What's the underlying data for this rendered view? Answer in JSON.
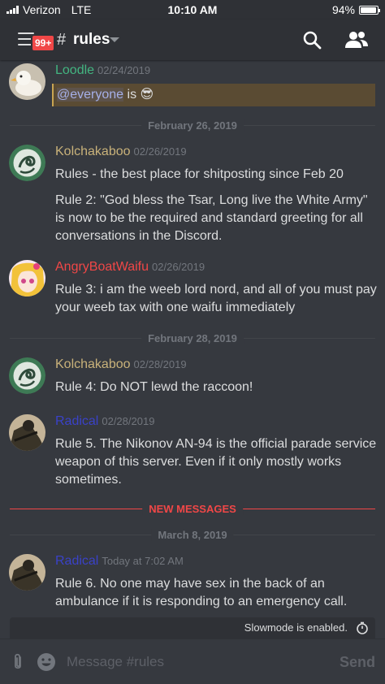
{
  "status": {
    "carrier": "Verizon",
    "network": "LTE",
    "time": "10:10 AM",
    "battery": "94%",
    "battery_level": 0.94
  },
  "header": {
    "badge": "99+",
    "hash": "#",
    "channel": "rules"
  },
  "messages": [
    {
      "author": "Loodle",
      "author_color": "#43b581",
      "timestamp": "02/24/2019",
      "mention": "@everyone",
      "text": " is 😎"
    },
    {
      "divider": "February 26, 2019"
    },
    {
      "author": "Kolchakaboo",
      "author_color": "#c9b27a",
      "timestamp": "02/26/2019",
      "lines": [
        "Rules - the best place for shitposting since Feb 20",
        "Rule 2: \"God bless the Tsar, Long live the White Army\" is now to be the required and standard greeting for all conversations in the Discord."
      ]
    },
    {
      "author": "AngryBoatWaifu",
      "author_color": "#f04747",
      "timestamp": "02/26/2019",
      "lines": [
        "Rule 3: i am the weeb lord nord, and all of you must pay your weeb tax with one waifu immediately"
      ]
    },
    {
      "divider": "February 28, 2019"
    },
    {
      "author": "Kolchakaboo",
      "author_color": "#c9b27a",
      "timestamp": "02/28/2019",
      "lines": [
        "Rule 4: Do NOT lewd the raccoon!"
      ]
    },
    {
      "author": "Radical",
      "author_color": "#3a42c8",
      "timestamp": "02/28/2019",
      "lines": [
        "Rule 5. The Nikonov AN-94 is the official parade service weapon of this server. Even if it only mostly works sometimes."
      ]
    },
    {
      "divider": "NEW MESSAGES"
    },
    {
      "divider": "March 8, 2019"
    },
    {
      "author": "Radical",
      "author_color": "#3a42c8",
      "timestamp": "Today at 7:02 AM",
      "lines": [
        "Rule 6. No one may have sex in the back of an ambulance if it is responding to an emergency call."
      ]
    }
  ],
  "slowmode": "Slowmode is enabled.",
  "composer": {
    "placeholder": "Message #rules",
    "send": "Send"
  },
  "icons": {
    "menu": "hamburger-icon",
    "search": "search-icon",
    "members": "members-icon",
    "attach": "paperclip-icon",
    "emoji": "emoji-icon",
    "slowmode": "stopwatch-icon"
  }
}
